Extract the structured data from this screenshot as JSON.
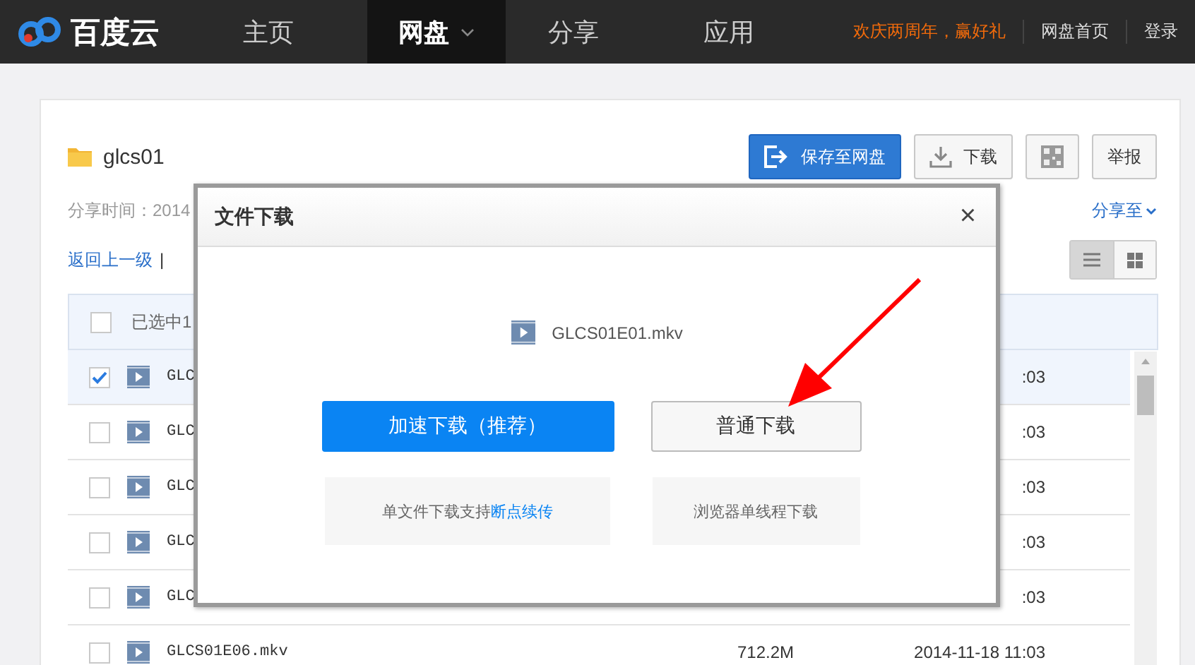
{
  "nav": {
    "logo": "百度云",
    "items": [
      {
        "label": "主页",
        "selected": false,
        "has_menu": false
      },
      {
        "label": "网盘",
        "selected": true,
        "has_menu": true
      },
      {
        "label": "分享",
        "selected": false,
        "has_menu": false
      },
      {
        "label": "应用",
        "selected": false,
        "has_menu": false
      }
    ],
    "promo": "欢庆两周年，赢好礼",
    "links": [
      "网盘首页",
      "登录"
    ]
  },
  "share": {
    "title": "glcs01",
    "buttons": [
      {
        "kind": "primary",
        "label": "保存至网盘"
      },
      {
        "kind": "download",
        "label": "下载"
      },
      {
        "kind": "qr"
      },
      {
        "kind": "plain",
        "label": "举报"
      }
    ],
    "share_time": "分享时间：2014",
    "share_to": "分享至",
    "back": "返回上一级",
    "separator": "|",
    "views": [
      {
        "kind": "list",
        "selected": true
      },
      {
        "kind": "grid",
        "selected": false
      }
    ]
  },
  "table": {
    "header": {
      "checked": false,
      "label": "已选中1"
    },
    "rows": [
      {
        "checked": true,
        "name": "GLC",
        "time": ":03"
      },
      {
        "checked": false,
        "name": "GLC",
        "time": ":03"
      },
      {
        "checked": false,
        "name": "GLC",
        "time": ":03"
      },
      {
        "checked": false,
        "name": "GLC",
        "time": ":03"
      },
      {
        "checked": false,
        "name": "GLC",
        "time": ":03"
      },
      {
        "checked": false,
        "name": "GLCS01E06.mkv",
        "size": "712.2M",
        "time": "2014-11-18 11:03"
      }
    ]
  },
  "dialog": {
    "title": "文件下载",
    "close": "×",
    "file": "GLCS01E01.mkv",
    "options": [
      {
        "kind": "primary",
        "label": "加速下载（推荐）",
        "hint": "单文件下载支持",
        "link": "断点续传"
      },
      {
        "kind": "plain",
        "label": "普通下载",
        "hint": "浏览器单线程下载"
      }
    ]
  }
}
